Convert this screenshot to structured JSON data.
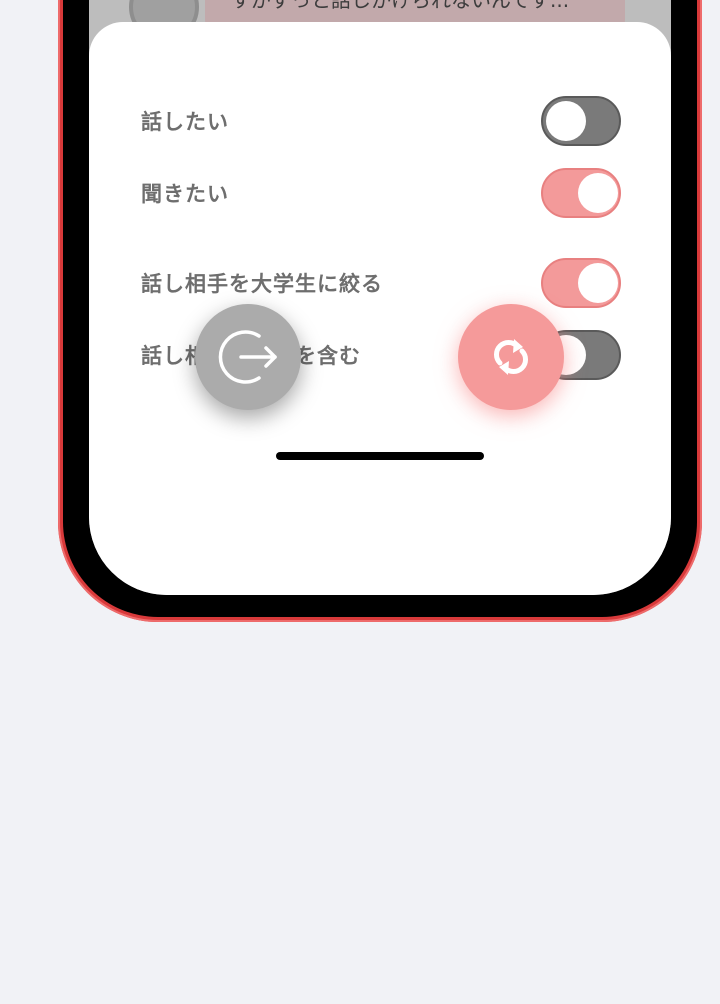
{
  "behind": {
    "message_text": "すがずっと話しかけられないんです..."
  },
  "settings": {
    "items": [
      {
        "label": "話したい",
        "on": false
      },
      {
        "label": "聞きたい",
        "on": true
      },
      {
        "label": "話し相手を大学生に絞る",
        "on": true
      },
      {
        "label": "話し相手に異性を含む",
        "on": false
      }
    ]
  },
  "actions": {
    "exit_icon": "exit-arrow-icon",
    "refresh_icon": "refresh-icon"
  },
  "colors": {
    "accent": "#f39a9a",
    "toggle_off": "#7a7a7a",
    "exit_button": "#ababab",
    "phone_frame": "#d8393a"
  }
}
